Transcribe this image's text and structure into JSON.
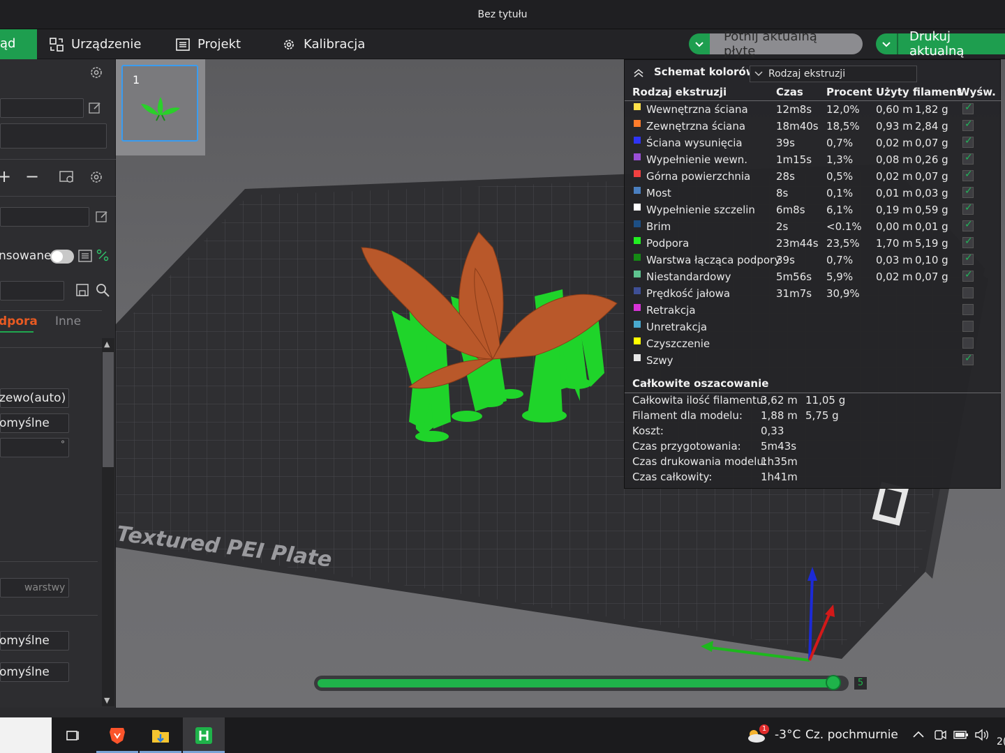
{
  "window": {
    "title": "Bez tytułu"
  },
  "nav": {
    "active_partial": "ąd",
    "device": "Urządzenie",
    "project": "Projekt",
    "calibration": "Kalibracja",
    "slice_label": "Potnij aktualną płytę",
    "print_label": "Drukuj aktualną"
  },
  "left": {
    "toggle_label": "nsowane",
    "tab_support": "dpora",
    "tab_other": "Inne",
    "dropdown_1": "zewo(auto)",
    "dropdown_2": "omyślne",
    "angle_unit": "°",
    "layers_unit": "warstwy",
    "dropdown_3": "omyślne",
    "dropdown_4": "omyślne"
  },
  "thumb": {
    "plate_number": "1"
  },
  "plate": {
    "label": "Textured PEI Plate"
  },
  "stats": {
    "title": "Schemat kolorów",
    "mode": "Rodzaj ekstruzji",
    "headers": {
      "type": "Rodzaj ekstruzji",
      "time": "Czas",
      "percent": "Procent",
      "used": "Użyty filament",
      "show": "Wyśw."
    },
    "rows": [
      {
        "name": "Wewnętrzna ściana",
        "color": "#ffe14a",
        "time": "12m8s",
        "pct": "12,0%",
        "m": "0,60 m",
        "g": "1,82 g",
        "show": true
      },
      {
        "name": "Zewnętrzna ściana",
        "color": "#ff7c2b",
        "time": "18m40s",
        "pct": "18,5%",
        "m": "0,93 m",
        "g": "2,84 g",
        "show": true
      },
      {
        "name": "Ściana wysunięcia",
        "color": "#2f34f5",
        "time": "39s",
        "pct": "0,7%",
        "m": "0,02 m",
        "g": "0,07 g",
        "show": true
      },
      {
        "name": "Wypełnienie wewn.",
        "color": "#9a4fd6",
        "time": "1m15s",
        "pct": "1,3%",
        "m": "0,08 m",
        "g": "0,26 g",
        "show": true
      },
      {
        "name": "Górna powierzchnia",
        "color": "#f04040",
        "time": "28s",
        "pct": "0,5%",
        "m": "0,02 m",
        "g": "0,07 g",
        "show": true
      },
      {
        "name": "Most",
        "color": "#4a7fc0",
        "time": "8s",
        "pct": "0,1%",
        "m": "0,01 m",
        "g": "0,03 g",
        "show": true
      },
      {
        "name": "Wypełnienie szczelin",
        "color": "#ffffff",
        "time": "6m8s",
        "pct": "6,1%",
        "m": "0,19 m",
        "g": "0,59 g",
        "show": true
      },
      {
        "name": "Brim",
        "color": "#1d4f85",
        "time": "2s",
        "pct": "<0.1%",
        "m": "0,00 m",
        "g": "0,01 g",
        "show": true
      },
      {
        "name": "Podpora",
        "color": "#22ee22",
        "time": "23m44s",
        "pct": "23,5%",
        "m": "1,70 m",
        "g": "5,19 g",
        "show": true
      },
      {
        "name": "Warstwa łącząca podpory",
        "color": "#158a15",
        "time": "39s",
        "pct": "0,7%",
        "m": "0,03 m",
        "g": "0,10 g",
        "show": true
      },
      {
        "name": "Niestandardowy",
        "color": "#5fc490",
        "time": "5m56s",
        "pct": "5,9%",
        "m": "0,02 m",
        "g": "0,07 g",
        "show": true
      },
      {
        "name": "Prędkość jałowa",
        "color": "#3e4f96",
        "time": "31m7s",
        "pct": "30,9%",
        "m": "",
        "g": "",
        "show": false
      },
      {
        "name": "Retrakcja",
        "color": "#d733d7",
        "time": "",
        "pct": "",
        "m": "",
        "g": "",
        "show": false
      },
      {
        "name": "Unretrakcja",
        "color": "#49a9cf",
        "time": "",
        "pct": "",
        "m": "",
        "g": "",
        "show": false
      },
      {
        "name": "Czyszczenie",
        "color": "#ffff00",
        "time": "",
        "pct": "",
        "m": "",
        "g": "",
        "show": false
      },
      {
        "name": "Szwy",
        "color": "#e6e6e6",
        "time": "",
        "pct": "",
        "m": "",
        "g": "",
        "show": true
      }
    ],
    "totals_title": "Całkowite oszacowanie",
    "totals": [
      {
        "label": "Całkowita ilość filamentu:",
        "v1": "3,62 m",
        "v2": "11,05 g"
      },
      {
        "label": "Filament dla modelu:",
        "v1": "1,88 m",
        "v2": "5,75 g"
      },
      {
        "label": "Koszt:",
        "v1": "0,33",
        "v2": ""
      },
      {
        "label": "Czas przygotowania:",
        "v1": "5m43s",
        "v2": ""
      },
      {
        "label": "Czas drukowania modelu:",
        "v1": "1h35m",
        "v2": ""
      },
      {
        "label": "Czas całkowity:",
        "v1": "1h41m",
        "v2": ""
      }
    ]
  },
  "layer_slider": {
    "value": "5",
    "fraction": 0.985
  },
  "taskbar": {
    "temperature": "-3°C",
    "weather": "Cz. pochmurnie",
    "weather_badge": "1",
    "clock_partial": "2("
  }
}
